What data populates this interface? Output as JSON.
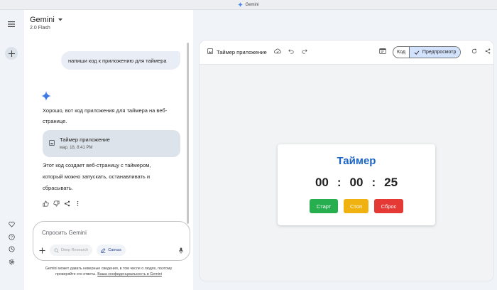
{
  "window": {
    "title": "Gemini"
  },
  "header": {
    "model_name": "Gemini",
    "model_version": "2.0 Flash"
  },
  "chat": {
    "user_message": "напиши код к приложению для таймера",
    "response_intro_line1": "Хорошо, вот код приложения для таймера на веб-",
    "response_intro_line2": "странице.",
    "card": {
      "title": "Таймер приложение",
      "date": "мар. 18, 8:41 PM"
    },
    "response_outro_line1": "Этот код создает веб-страницу с таймером,",
    "response_outro_line2": "который можно запускать, останавливать и",
    "response_outro_line3": "сбрасывать."
  },
  "input": {
    "placeholder": "Спросить Gemini",
    "deep_research_label": "Deep Research",
    "canvas_label": "Canvas"
  },
  "disclaimer": {
    "line1": "Gemini может давать неверные сведения, в том числе о людях, поэтому",
    "line2_prefix": "проверяйте его ответы.",
    "privacy_link": "Ваша конфиденциальность в Gemini"
  },
  "canvas": {
    "title": "Таймер приложение",
    "code_tab": "Код",
    "preview_tab": "Предпросмотр"
  },
  "timer": {
    "heading": "Таймер",
    "hours": "00",
    "minutes": "00",
    "seconds": "25",
    "separator": ":",
    "start_label": "Старт",
    "stop_label": "Стоп",
    "reset_label": "Сброс"
  },
  "colors": {
    "accent_blue": "#1a64c8",
    "start_green": "#27ae4f",
    "stop_yellow": "#efb211",
    "reset_red": "#e53935",
    "preview_selected": "#d3e3fd"
  }
}
